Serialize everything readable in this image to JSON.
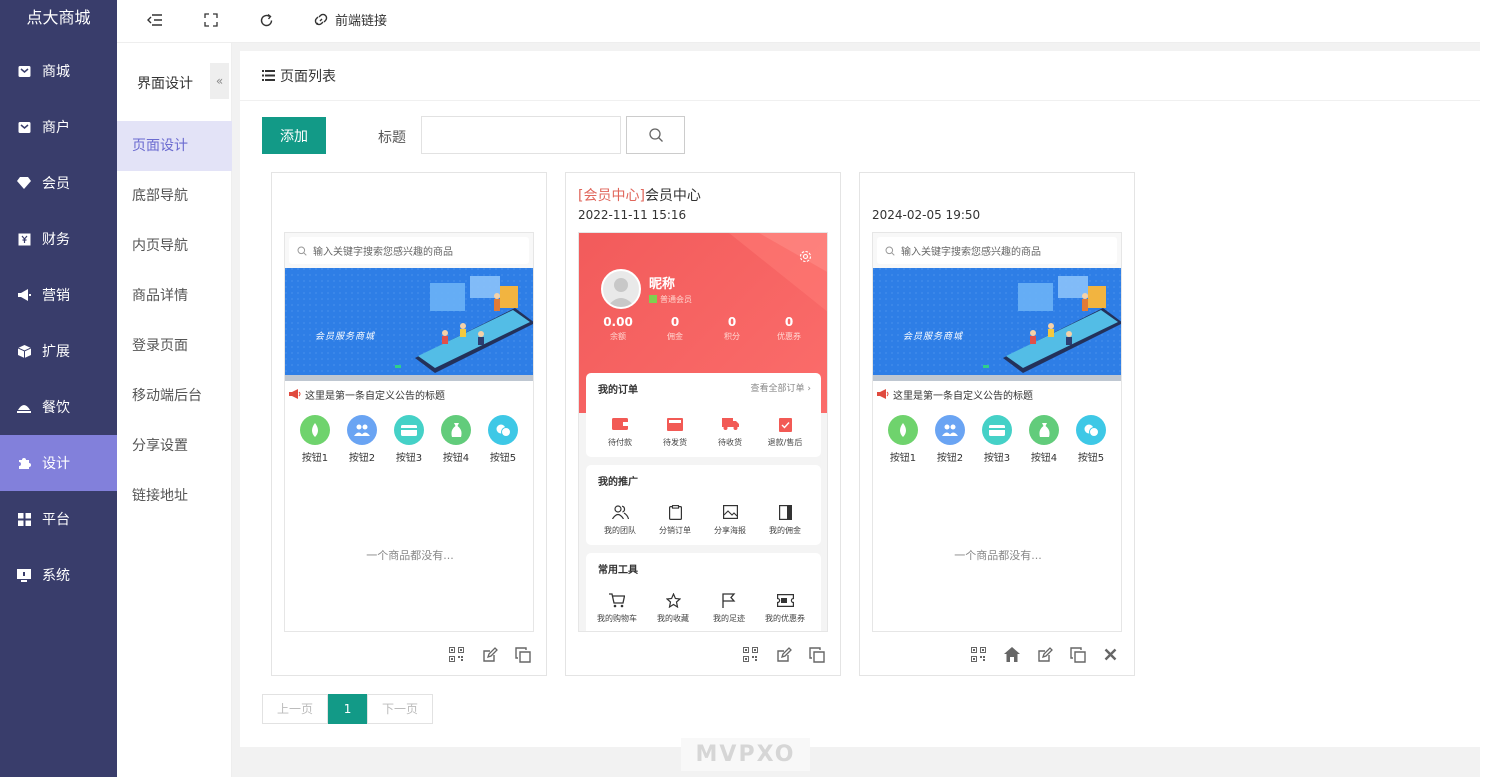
{
  "sidebar": {
    "logo": "点大商城",
    "items": [
      {
        "label": "商城",
        "icon": "shop-icon"
      },
      {
        "label": "商户",
        "icon": "merchant-icon"
      },
      {
        "label": "会员",
        "icon": "member-icon"
      },
      {
        "label": "财务",
        "icon": "finance-icon"
      },
      {
        "label": "营销",
        "icon": "megaphone-icon"
      },
      {
        "label": "扩展",
        "icon": "box-icon"
      },
      {
        "label": "餐饮",
        "icon": "dining-icon"
      },
      {
        "label": "设计",
        "icon": "puzzle-icon",
        "active": true
      },
      {
        "label": "平台",
        "icon": "grid-icon"
      },
      {
        "label": "系统",
        "icon": "monitor-icon"
      }
    ]
  },
  "topbar": {
    "frontend_link": "前端链接"
  },
  "subnav": {
    "title": "界面设计",
    "collapse": "«",
    "items": [
      "页面设计",
      "底部导航",
      "内页导航",
      "商品详情",
      "登录页面",
      "移动端后台",
      "分享设置",
      "链接地址"
    ],
    "active": 0
  },
  "main": {
    "heading": "页面列表",
    "add_label": "添加",
    "title_label": "标题",
    "title_value": "",
    "title_placeholder": ""
  },
  "cards": [
    {
      "tag": "",
      "title": "",
      "date": "",
      "search_placeholder": "输入关键字搜索您感兴趣的商品",
      "banner_text": "会员服务商城",
      "notice": "这里是第一条自定义公告的标题",
      "buttons": [
        "按钮1",
        "按钮2",
        "按钮3",
        "按钮4",
        "按钮5"
      ],
      "empty": "一个商品都没有..."
    },
    {
      "tag": "[会员中心]",
      "title": "会员中心",
      "date": "2022-11-11 15:16",
      "nickname": "昵称",
      "level": "普通会员",
      "stats": [
        {
          "value": "0.00",
          "label": "余额"
        },
        {
          "value": "0",
          "label": "佣金"
        },
        {
          "value": "0",
          "label": "积分"
        },
        {
          "value": "0",
          "label": "优惠券"
        }
      ],
      "orders_title": "我的订单",
      "orders_more": "查看全部订单 ›",
      "orders": [
        "待付款",
        "待发货",
        "待收货",
        "退款/售后"
      ],
      "promo_title": "我的推广",
      "promo": [
        "我的团队",
        "分销订单",
        "分享海报",
        "我的佣金"
      ],
      "tools_title": "常用工具",
      "tools": [
        "我的购物车",
        "我的收藏",
        "我的足迹",
        "我的优惠券"
      ]
    },
    {
      "tag": "",
      "title": "",
      "date": "2024-02-05 19:50",
      "search_placeholder": "输入关键字搜索您感兴趣的商品",
      "banner_text": "会员服务商城",
      "notice": "这里是第一条自定义公告的标题",
      "buttons": [
        "按钮1",
        "按钮2",
        "按钮3",
        "按钮4",
        "按钮5"
      ],
      "empty": "一个商品都没有..."
    }
  ],
  "pager": {
    "prev": "上一页",
    "current": "1",
    "next": "下一页"
  },
  "watermark": "MVPXO",
  "colors": {
    "sidebar_bg": "#393d6b",
    "sidebar_active": "#8280db",
    "primary": "#129a87",
    "member_red": "#f25b5b"
  }
}
